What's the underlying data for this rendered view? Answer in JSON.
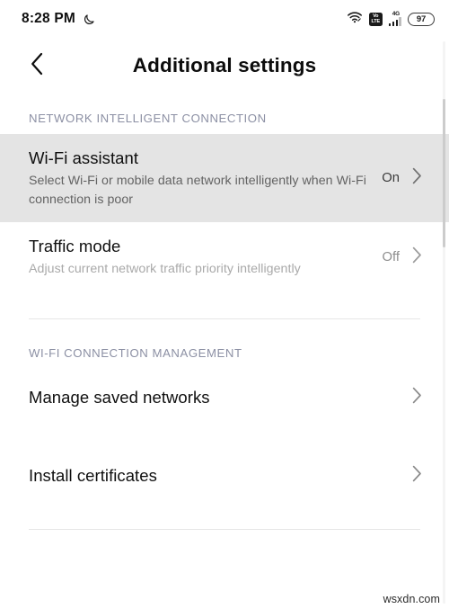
{
  "status_bar": {
    "time": "8:28 PM",
    "dnd_icon": "crescent-moon-icon",
    "wifi_icon": "wifi-icon",
    "volte_line1": "Vo",
    "volte_line2": "LTE",
    "network_generation": "4G",
    "signal_icon": "signal-bars-icon",
    "battery_level": "97"
  },
  "header": {
    "back_icon": "chevron-left-icon",
    "title": "Additional settings"
  },
  "sections": [
    {
      "label": "NETWORK INTELLIGENT CONNECTION",
      "rows": [
        {
          "title": "Wi-Fi assistant",
          "subtitle": "Select Wi-Fi or mobile data network intelligently when Wi-Fi connection is poor",
          "value": "On",
          "chevron": "chevron-right-icon"
        },
        {
          "title": "Traffic mode",
          "subtitle": "Adjust current network traffic priority intelligently",
          "value": "Off",
          "chevron": "chevron-right-icon"
        }
      ]
    },
    {
      "label": "WI-FI CONNECTION MANAGEMENT",
      "rows": [
        {
          "title": "Manage saved networks",
          "value": "",
          "chevron": "chevron-right-icon"
        },
        {
          "title": "Install certificates",
          "value": "",
          "chevron": "chevron-right-icon"
        }
      ]
    }
  ],
  "watermark": "wsxdn.com",
  "colors": {
    "background": "#ffffff",
    "highlight_row": "#e4e4e4",
    "section_label": "#8c90a4",
    "divider": "#e6e6e6",
    "primary_text": "#0f0f0f",
    "secondary_text": "#636363"
  }
}
